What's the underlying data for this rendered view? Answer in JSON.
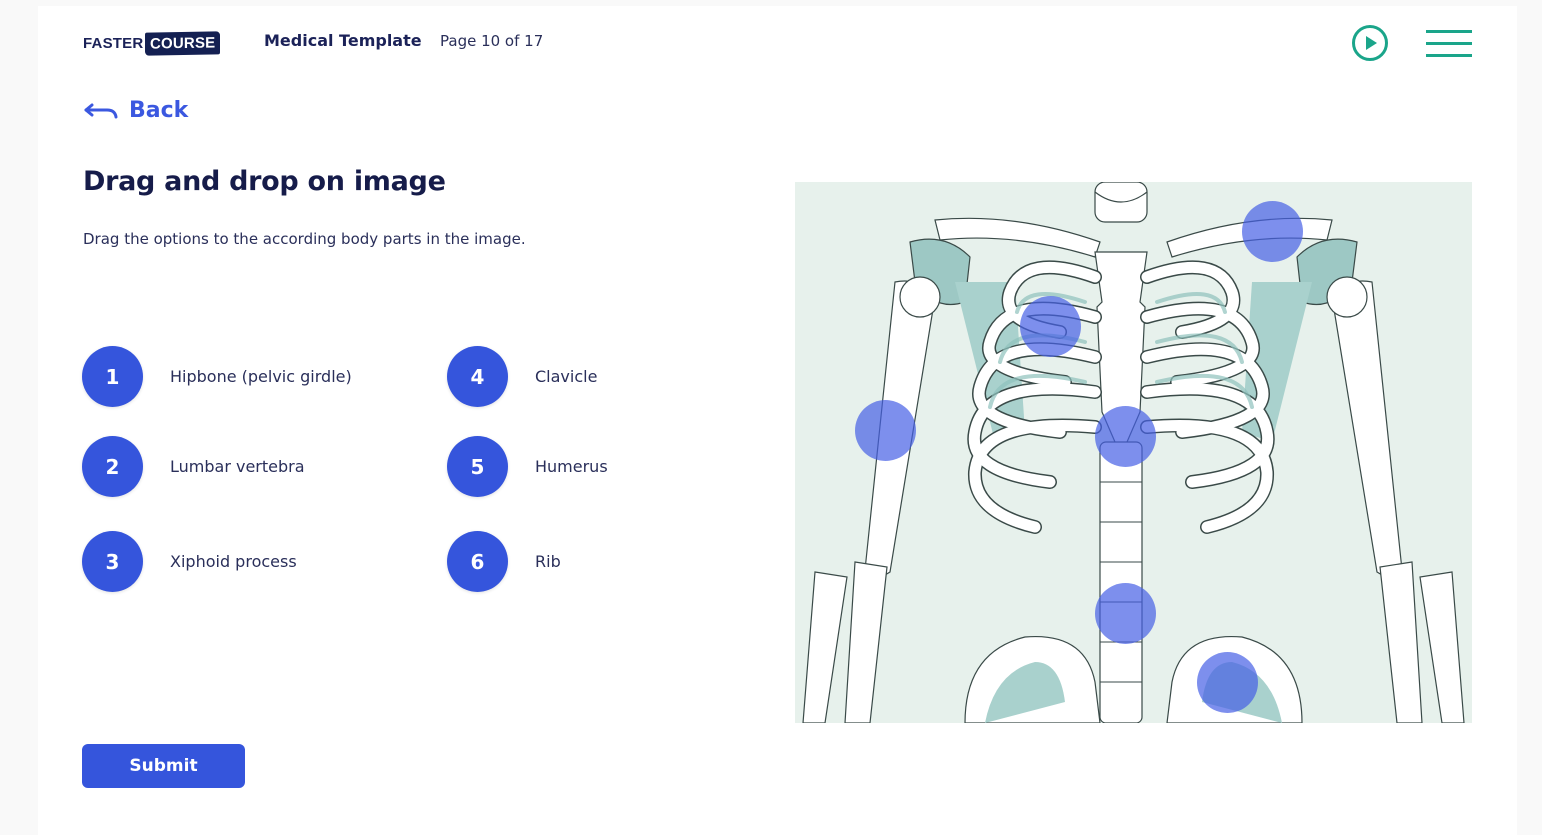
{
  "header": {
    "logo_part1": "FASTER",
    "logo_part2": "COURSE",
    "course_title": "Medical Template",
    "page_indicator": "Page 10 of 17",
    "play_icon": "play-circle-icon",
    "menu_icon": "hamburger-menu-icon"
  },
  "nav": {
    "back_label": "Back",
    "back_icon": "arrow-back-icon"
  },
  "main": {
    "title": "Drag and drop on image",
    "instructions": "Drag the options to the according body parts in the image."
  },
  "options": [
    {
      "number": "1",
      "label": "Hipbone (pelvic girdle)"
    },
    {
      "number": "2",
      "label": "Lumbar vertebra"
    },
    {
      "number": "3",
      "label": "Xiphoid process"
    },
    {
      "number": "4",
      "label": "Clavicle"
    },
    {
      "number": "5",
      "label": "Humerus"
    },
    {
      "number": "6",
      "label": "Rib"
    }
  ],
  "image": {
    "description": "Anterior view of human skeleton torso",
    "drop_zones_count": 6
  },
  "submit_label": "Submit",
  "colors": {
    "primary": "#3555dc",
    "accent": "#1aa58a",
    "heading": "#161c4a",
    "image_bg": "#e7f1ec"
  }
}
